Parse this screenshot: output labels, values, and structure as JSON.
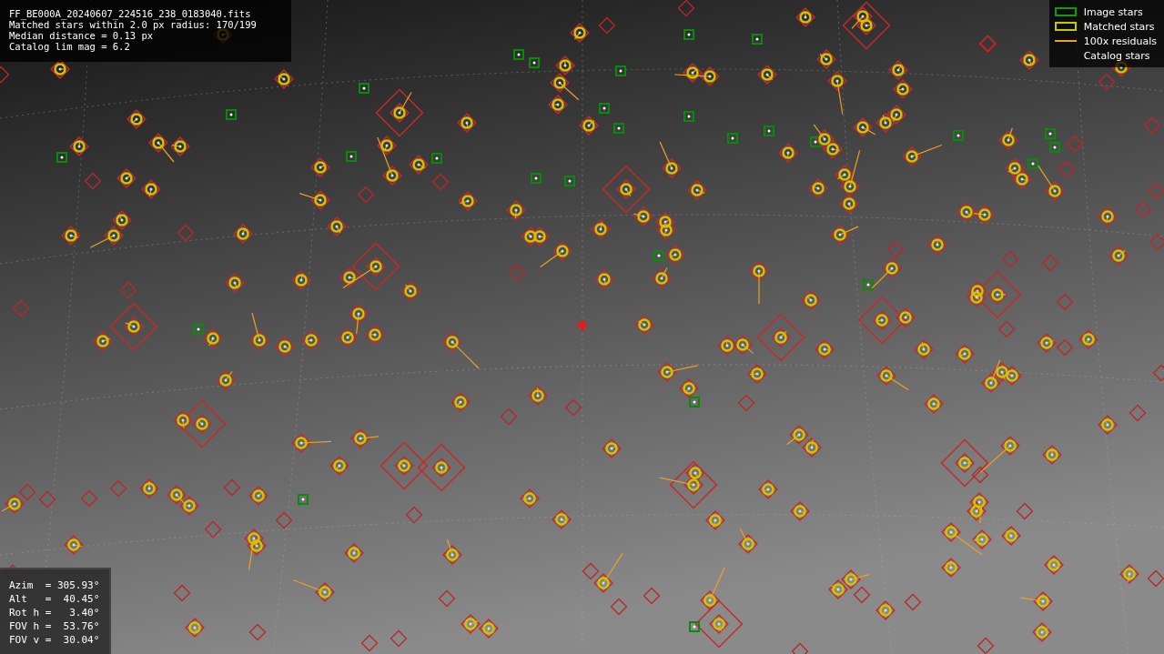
{
  "info_box": {
    "lines": [
      "FF_BE000A_20240607_224516_238_0183040.fits",
      "Matched stars within 2.0 px radius: 170/199",
      "Median distance = 0.13 px",
      "Catalog lim mag = 6.2"
    ]
  },
  "legend": [
    {
      "kind": "image",
      "label": "Image stars"
    },
    {
      "kind": "matched",
      "label": "Matched stars"
    },
    {
      "kind": "residual",
      "label": "100x residuals"
    },
    {
      "kind": "catalog",
      "label": "Catalog stars"
    }
  ],
  "pointing_box": {
    "lines": [
      "Azim  = 305.93°",
      "Alt   =  40.45°",
      "Rot h =   3.40°",
      "FOV h =  53.76°",
      "FOV v =  30.04°"
    ]
  }
}
